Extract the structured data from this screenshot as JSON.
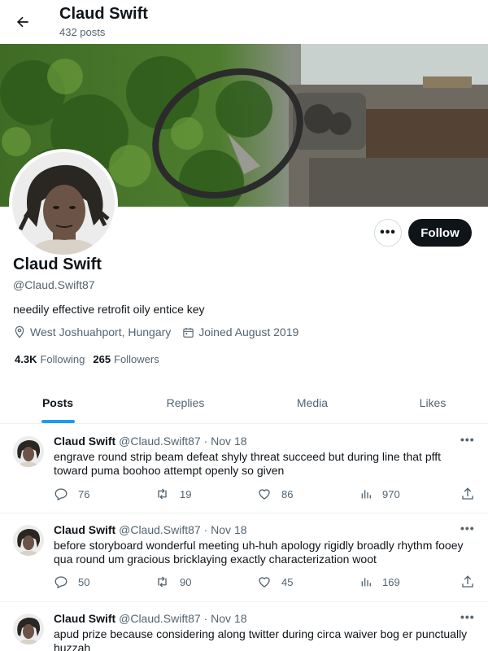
{
  "header": {
    "title": "Claud Swift",
    "post_count": "432 posts"
  },
  "profile": {
    "name": "Claud Swift",
    "handle": "@Claud.Swift87",
    "bio": "needily effective retrofit oily entice key",
    "location": "West Joshuahport, Hungary",
    "joined": "Joined August 2019",
    "following_count": "4.3K",
    "following_label": "Following",
    "followers_count": "265",
    "followers_label": "Followers",
    "follow_label": "Follow",
    "more_label": "•••"
  },
  "tabs": [
    {
      "label": "Posts",
      "active": true
    },
    {
      "label": "Replies",
      "active": false
    },
    {
      "label": "Media",
      "active": false
    },
    {
      "label": "Likes",
      "active": false
    }
  ],
  "tweets": [
    {
      "name": "Claud Swift",
      "meta": "@Claud.Swift87 · Nov 18",
      "text": "engrave round strip beam defeat shyly threat succeed but during line that pfft toward puma boohoo attempt openly so given",
      "replies": "76",
      "retweets": "19",
      "likes": "86",
      "views": "970"
    },
    {
      "name": "Claud Swift",
      "meta": "@Claud.Swift87 · Nov 18",
      "text": "before storyboard wonderful meeting uh-huh apology rigidly broadly rhythm fooey qua round um gracious bricklaying exactly characterization woot",
      "replies": "50",
      "retweets": "90",
      "likes": "45",
      "views": "169"
    },
    {
      "name": "Claud Swift",
      "meta": "@Claud.Swift87 · Nov 18",
      "text": "apud prize because considering along twitter during circa waiver bog er punctually huzzah",
      "replies": "",
      "retweets": "",
      "likes": "",
      "views": ""
    }
  ],
  "colors": {
    "accent": "#1d9bf0",
    "text_primary": "#0f1419",
    "text_secondary": "#536471",
    "border": "#eff3f4"
  },
  "icons": {
    "back": "arrow-left-icon",
    "location": "location-pin-icon",
    "calendar": "calendar-icon",
    "reply": "reply-icon",
    "retweet": "retweet-icon",
    "like": "heart-icon",
    "views": "views-chart-icon",
    "share": "share-icon"
  }
}
